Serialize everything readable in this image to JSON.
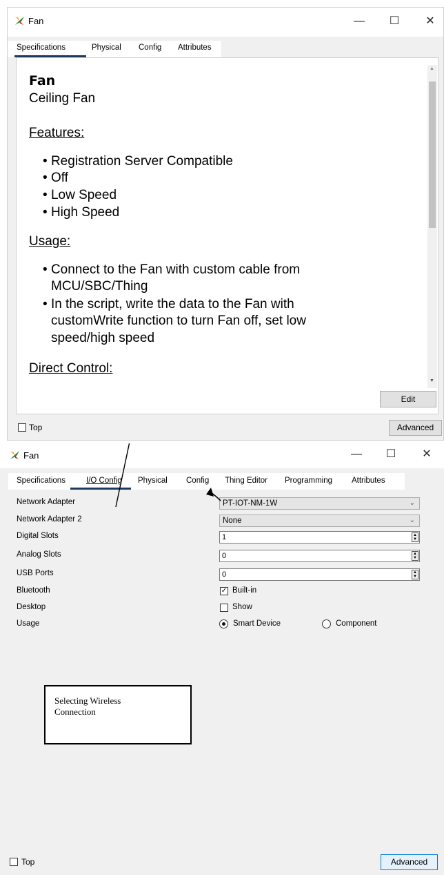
{
  "window1": {
    "title": "Fan",
    "tabs": [
      "Specifications",
      "Physical",
      "Config",
      "Attributes"
    ],
    "spec": {
      "name": "Fan",
      "subtitle": "Ceiling Fan",
      "features_heading": "Features:",
      "features": [
        "Registration Server Compatible",
        "Off",
        "Low Speed",
        "High Speed"
      ],
      "usage_heading": "Usage:",
      "usage_1_line1": "Connect to the Fan with custom cable from",
      "usage_1_line2": "MCU/SBC/Thing",
      "usage_2_line1": "In the script, write the data to the Fan with",
      "usage_2_line2": "customWrite function to turn Fan off, set low",
      "usage_2_line3": "speed/high speed",
      "direct_heading": "Direct Control:"
    },
    "edit_label": "Edit",
    "top_label": "Top",
    "advanced_label": "Advanced"
  },
  "window2": {
    "title": "Fan",
    "tabs": [
      "Specifications",
      "I/O Config",
      "Physical",
      "Config",
      "Thing Editor",
      "Programming",
      "Attributes"
    ],
    "rows": {
      "network_adapter": {
        "label": "Network Adapter",
        "value": "PT-IOT-NM-1W"
      },
      "network_adapter_2": {
        "label": "Network Adapter 2",
        "value": "None"
      },
      "digital_slots": {
        "label": "Digital Slots",
        "value": "1"
      },
      "analog_slots": {
        "label": "Analog Slots",
        "value": "0"
      },
      "usb_ports": {
        "label": "USB Ports",
        "value": "0"
      },
      "bluetooth": {
        "label": "Bluetooth",
        "option": "Built-in",
        "checked": true
      },
      "desktop": {
        "label": "Desktop",
        "option": "Show",
        "checked": false
      },
      "usage": {
        "label": "Usage",
        "option1": "Smart Device",
        "option2": "Component",
        "selected": "Smart Device"
      }
    },
    "annotation": {
      "line1": "Selecting Wireless",
      "line2": "Connection"
    },
    "top_label": "Top",
    "advanced_label": "Advanced"
  },
  "colors": {
    "tab_underline": "#1e3a5f",
    "accent": "#0078d7",
    "window_bg": "#f0f0f0"
  }
}
